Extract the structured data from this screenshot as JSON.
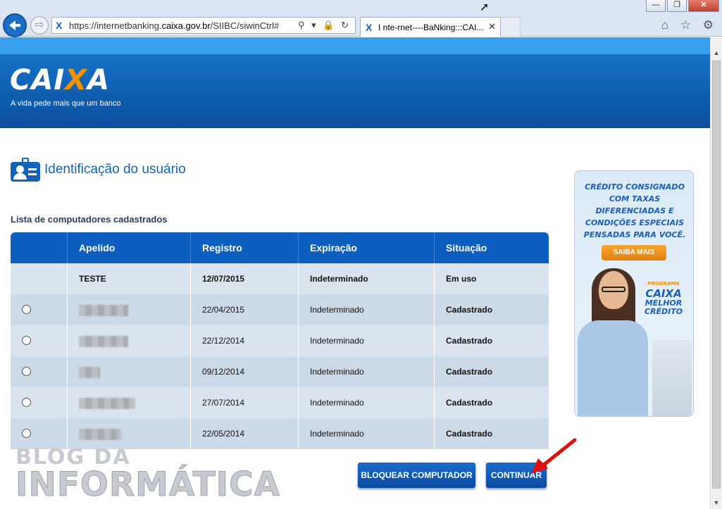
{
  "browser": {
    "url_prefix": "https://internetbanking.",
    "url_host": "caixa.gov.br",
    "url_path": "/SIIBC/siwinCtrl#",
    "tab_title": "I nte-rnet----BaNking:::CAI...",
    "favicon": "X",
    "win_minimize": "—",
    "win_restore": "❐",
    "win_close": "✕",
    "tab_close": "✕",
    "addr_icons": "⚲ ▾ 🔒 ↻",
    "tool_icons": "⌂ ☆ ⚙"
  },
  "header": {
    "logo_a": "CAI",
    "logo_x": "X",
    "logo_b": "A",
    "slogan": "A vida pede mais que um banco"
  },
  "main": {
    "title": "Identificação do usuário",
    "list_label": "Lista de computadores cadastrados"
  },
  "table": {
    "headers": [
      "",
      "Apelido",
      "Registro",
      "Expiração",
      "Situação"
    ],
    "rows": [
      {
        "apelido": "TESTE",
        "registro": "12/07/2015",
        "expiracao": "Indeterminado",
        "situacao": "Em uso"
      },
      {
        "apelido": "",
        "registro": "22/04/2015",
        "expiracao": "Indeterminado",
        "situacao": "Cadastrado"
      },
      {
        "apelido": "",
        "registro": "22/12/2014",
        "expiracao": "Indeterminado",
        "situacao": "Cadastrado"
      },
      {
        "apelido": "",
        "registro": "09/12/2014",
        "expiracao": "Indeterminado",
        "situacao": "Cadastrado"
      },
      {
        "apelido": "",
        "registro": "27/07/2014",
        "expiracao": "Indeterminado",
        "situacao": "Cadastrado"
      },
      {
        "apelido": "",
        "registro": "22/05/2014",
        "expiracao": "Indeterminado",
        "situacao": "Cadastrado"
      }
    ]
  },
  "actions": {
    "block_label": "BLOQUEAR COMPUTADOR",
    "continue_label": "CONTINUAR"
  },
  "ad": {
    "line1": "CRÉDITO CONSIGNADO",
    "line2": "COM TAXAS",
    "line3": "DIFERENCIADAS E",
    "line4": "CONDIÇÕES ESPECIAIS",
    "line5": "PENSADAS PARA VOCÊ.",
    "button": "SAIBA MAIS",
    "brand_small": "PROGRAMA",
    "brand_big": "CAIXA",
    "brand_line2": "MELHOR",
    "brand_line3": "CRÉDITO"
  },
  "watermark": {
    "line1": "BLOG DA",
    "line2": "INFORMÁTICA"
  },
  "colors": {
    "brand_blue": "#0c5fbf",
    "brand_orange": "#f39200",
    "annotation_red": "#e01010"
  }
}
